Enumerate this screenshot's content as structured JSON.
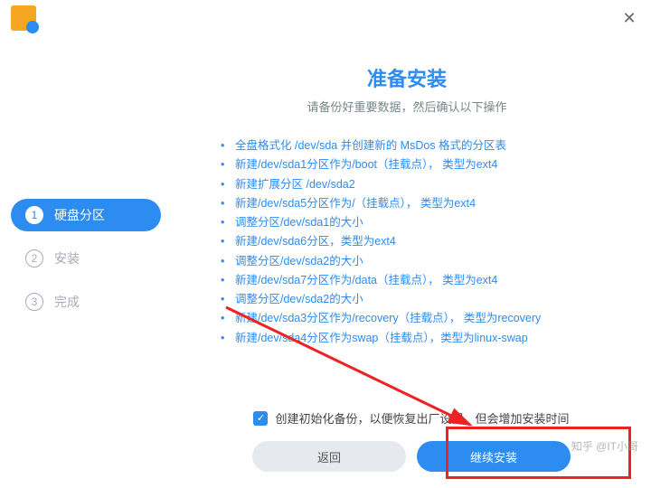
{
  "titlebar": {
    "close": "✕"
  },
  "sidebar": {
    "steps": [
      {
        "num": "1",
        "label": "硬盘分区",
        "active": true
      },
      {
        "num": "2",
        "label": "安装",
        "active": false
      },
      {
        "num": "3",
        "label": "完成",
        "active": false
      }
    ]
  },
  "main": {
    "heading": "准备安装",
    "subheading": "请备份好重要数据，然后确认以下操作",
    "operations": [
      "全盘格式化 /dev/sda 并创建新的 MsDos 格式的分区表",
      "新建/dev/sda1分区作为/boot（挂载点），  类型为ext4",
      "新建扩展分区 /dev/sda2",
      "新建/dev/sda5分区作为/（挂载点），  类型为ext4",
      "调整分区/dev/sda1的大小",
      "新建/dev/sda6分区，类型为ext4",
      "调整分区/dev/sda2的大小",
      "新建/dev/sda7分区作为/data（挂载点），  类型为ext4",
      "调整分区/dev/sda2的大小",
      "新建/dev/sda3分区作为/recovery（挂载点），  类型为recovery",
      "新建/dev/sda4分区作为swap（挂载点），类型为linux-swap"
    ]
  },
  "bottom": {
    "checkbox_label": "创建初始化备份，以便恢复出厂设置，但会增加安装时间",
    "checkbox_checked": true,
    "back_label": "返回",
    "continue_label": "继续安装"
  },
  "watermark": "知乎 @IT小哥"
}
